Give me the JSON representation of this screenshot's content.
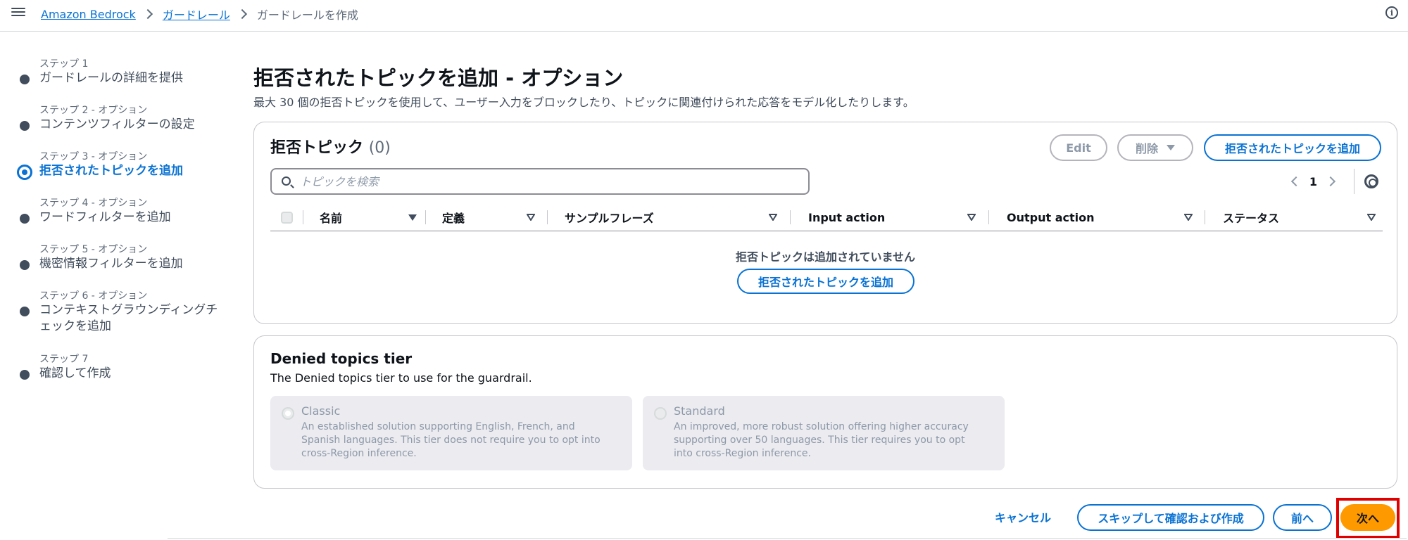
{
  "breadcrumb": {
    "items": [
      "Amazon Bedrock",
      "ガードレール"
    ],
    "current": "ガードレールを作成"
  },
  "steps": [
    {
      "num": "ステップ 1",
      "label": "ガードレールの詳細を提供"
    },
    {
      "num": "ステップ 2 - オプション",
      "label": "コンテンツフィルターの設定"
    },
    {
      "num": "ステップ 3 - オプション",
      "label": "拒否されたトピックを追加"
    },
    {
      "num": "ステップ 4 - オプション",
      "label": "ワードフィルターを追加"
    },
    {
      "num": "ステップ 5 - オプション",
      "label": "機密情報フィルターを追加"
    },
    {
      "num": "ステップ 6 - オプション",
      "label": "コンテキストグラウンディングチェックを追加"
    },
    {
      "num": "ステップ 7",
      "label": "確認して作成"
    }
  ],
  "page": {
    "title": "拒否されたトピックを追加 - オプション",
    "description": "最大 30 個の拒否トピックを使用して、ユーザー入力をブロックしたり、トピックに関連付けられた応答をモデル化したりします。"
  },
  "denied_topics": {
    "title": "拒否トピック",
    "count": "(0)",
    "edit_label": "Edit",
    "delete_label": "削除",
    "add_label": "拒否されたトピックを追加",
    "search_placeholder": "トピックを検索",
    "page_number": "1",
    "columns": [
      "名前",
      "定義",
      "サンプルフレーズ",
      "Input action",
      "Output action",
      "ステータス"
    ],
    "empty_text": "拒否トピックは追加されていません",
    "empty_add_label": "拒否されたトピックを追加"
  },
  "tier": {
    "title": "Denied topics tier",
    "description": "The Denied topics tier to use for the guardrail.",
    "options": [
      {
        "title": "Classic",
        "description": "An established solution supporting English, French, and Spanish languages. This tier does not require you to opt into cross-Region inference."
      },
      {
        "title": "Standard",
        "description": "An improved, more robust solution offering higher accuracy supporting over 50 languages. This tier requires you to opt into cross-Region inference."
      }
    ]
  },
  "footer": {
    "cancel_label": "キャンセル",
    "skip_label": "スキップして確認および作成",
    "prev_label": "前へ",
    "next_label": "次へ"
  }
}
